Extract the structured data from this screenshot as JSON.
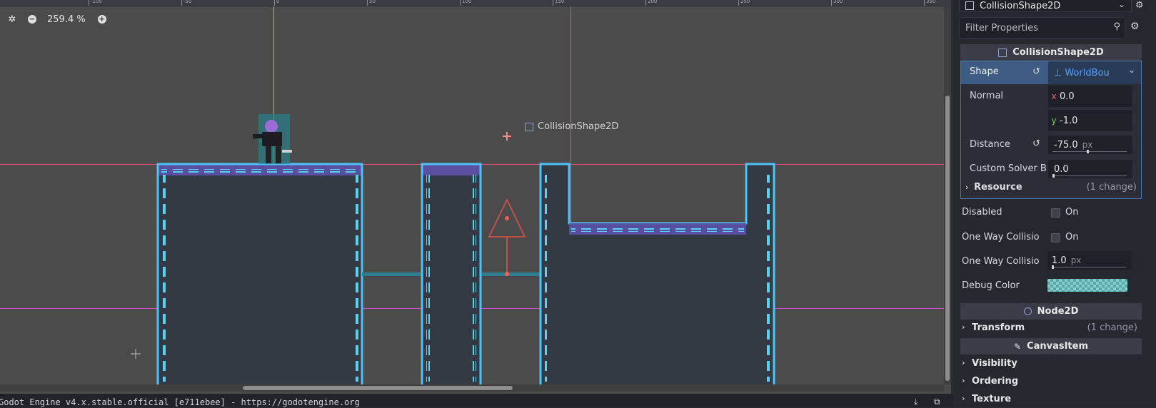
{
  "viewport": {
    "zoom_label": "259.4 %",
    "ruler_labels": [
      "-100",
      "-50",
      "0",
      "50",
      "100",
      "150",
      "200",
      "250",
      "300",
      "350"
    ],
    "node_label": "CollisionShape2D"
  },
  "status_bar": {
    "text": "Godot Engine v4.x.stable.official [e711ebee] - https://godotengine.org"
  },
  "inspector": {
    "node_name": "CollisionShape2D",
    "filter_placeholder": "Filter Properties",
    "collision_section": "CollisionShape2D",
    "shape": {
      "label": "Shape",
      "value": "WorldBou"
    },
    "normal": {
      "label": "Normal",
      "x_tag": "x",
      "x": "0.0",
      "y_tag": "y",
      "y": "-1.0"
    },
    "distance": {
      "label": "Distance",
      "value": "-75.0",
      "unit": "px"
    },
    "custom_solver": {
      "label": "Custom Solver B",
      "value": "0.0"
    },
    "resource": {
      "label": "Resource",
      "note": "(1 change)"
    },
    "disabled": {
      "label": "Disabled",
      "on": "On"
    },
    "one_way": {
      "label": "One Way Collisio",
      "on": "On"
    },
    "one_way_margin": {
      "label": "One Way Collisio",
      "value": "1.0",
      "unit": "px"
    },
    "debug_color": {
      "label": "Debug Color",
      "color": "#7fd1d1"
    },
    "node2d_section": "Node2D",
    "transform": {
      "label": "Transform",
      "note": "(1 change)"
    },
    "canvasitem_section": "CanvasItem",
    "visibility": {
      "label": "Visibility"
    },
    "ordering": {
      "label": "Ordering"
    },
    "texture": {
      "label": "Texture"
    }
  },
  "colors": {
    "viewport_bg": "#4b4b4b",
    "tile_outline": "#4fc3f7",
    "tile_fill": "#333a43",
    "accent_blue": "#4f78b0"
  }
}
